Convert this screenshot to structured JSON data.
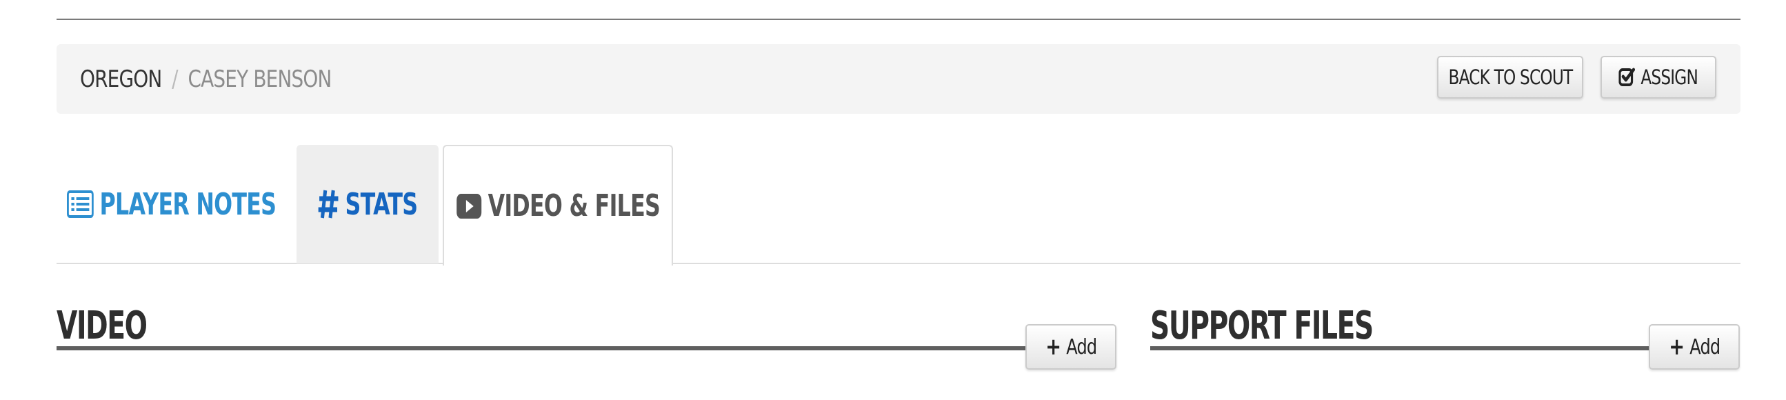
{
  "breadcrumb": {
    "team": "OREGON",
    "separator": "/",
    "player": "CASEY BENSON"
  },
  "actions": {
    "back_label": "BACK TO SCOUT",
    "assign_label": "ASSIGN"
  },
  "tabs": [
    {
      "label": "PLAYER NOTES",
      "icon": "list-icon",
      "state": "inactive",
      "color": "#2d8fd0"
    },
    {
      "label": "STATS",
      "icon": "hash-icon",
      "state": "hover",
      "color": "#1565c0"
    },
    {
      "label": "VIDEO & FILES",
      "icon": "play-icon",
      "state": "active",
      "color": "#555555"
    }
  ],
  "sections": {
    "video": {
      "title": "VIDEO",
      "add_label": "Add"
    },
    "support_files": {
      "title": "SUPPORT FILES",
      "add_label": "Add"
    }
  },
  "colors": {
    "accent_blue": "#2d8fd0",
    "dark_blue": "#1565c0",
    "heading": "#2f2f2f"
  }
}
